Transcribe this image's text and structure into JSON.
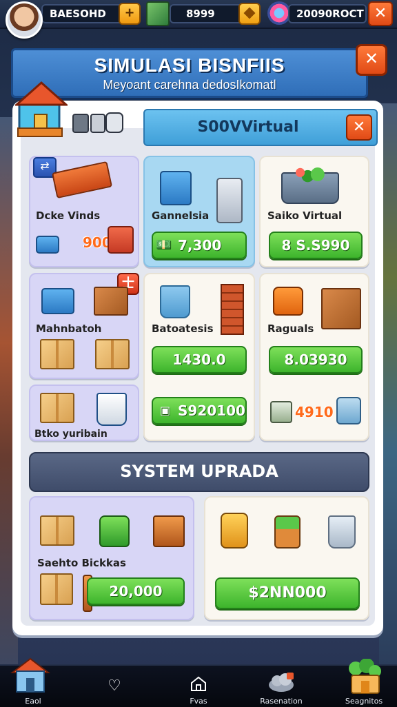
{
  "topbar": {
    "player_name": "BAESOHD",
    "cash_value": "8999",
    "gems_value": "20090ROCT",
    "plus_label": "+",
    "close_label": "✕"
  },
  "banner": {
    "title": "SIMULASI BISNFIIS",
    "subtitle": "Meyoant carehna dedosIkomatl",
    "close_label": "✕"
  },
  "store": {
    "header": "S00VVirtual",
    "close_label": "✕",
    "badge_symbol": "士",
    "cards": [
      {
        "label": "Dcke Vinds",
        "price": "900"
      },
      {
        "label": "Gannelsia",
        "price": "7,300"
      },
      {
        "label": "Saiko Virtual",
        "price": "8 S.S990"
      },
      {
        "label": "Mahnbatoh"
      },
      {
        "label": "Batoatesis",
        "price": "1430.0"
      },
      {
        "label": "Raguals",
        "price": "8.03930"
      },
      {
        "label": "Btko yuribain"
      },
      {
        "price": "S920100"
      },
      {
        "price": "4910"
      }
    ]
  },
  "system": {
    "title": "SYSTEM UPRADA",
    "cards": [
      {
        "label": "Saehto Bickkas",
        "price": "20,000"
      },
      {
        "price": "$2NN000"
      }
    ]
  },
  "bottomnav": {
    "items": [
      {
        "label": "Eaol",
        "icon": "house-icon"
      },
      {
        "label": "",
        "icon": "heart-icon"
      },
      {
        "label": "Fvas",
        "icon": "home-outline-icon"
      },
      {
        "label": "Rasenation",
        "icon": "cloud-icon"
      },
      {
        "label": "Seagnitos",
        "icon": "plant-shop-icon"
      }
    ]
  },
  "colors": {
    "accent_orange": "#e04a16",
    "button_green": "#3db42c",
    "banner_blue": "#2f6eb8",
    "panel_bg": "#e4e7ef"
  }
}
